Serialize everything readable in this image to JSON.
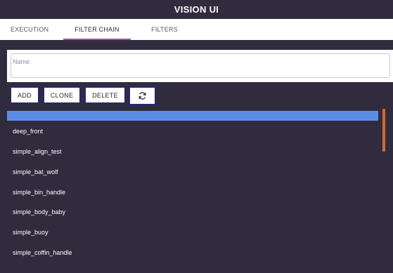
{
  "app": {
    "title": "VISION UI"
  },
  "tabs": [
    {
      "label": "EXECUTION",
      "active": false
    },
    {
      "label": "FILTER CHAIN",
      "active": true
    },
    {
      "label": "FILTERS",
      "active": false
    }
  ],
  "name_field": {
    "label": "Name",
    "value": ""
  },
  "actions": {
    "add_label": "ADD",
    "clone_label": "CLONE",
    "delete_label": "DELETE",
    "refresh_icon": "refresh-icon"
  },
  "filter_chains": {
    "selected_label": "",
    "items": [
      "deep_front",
      "simple_align_test",
      "simple_bat_wolf",
      "simple_bin_handle",
      "simple_body_baby",
      "simple_buoy",
      "simple_coffin_handle"
    ]
  },
  "colors": {
    "background": "#302c3e",
    "tab_underline": "#b44a9f",
    "selection": "#5b8de8",
    "scrollbar": "#d4692a",
    "button_border": "#272771"
  }
}
